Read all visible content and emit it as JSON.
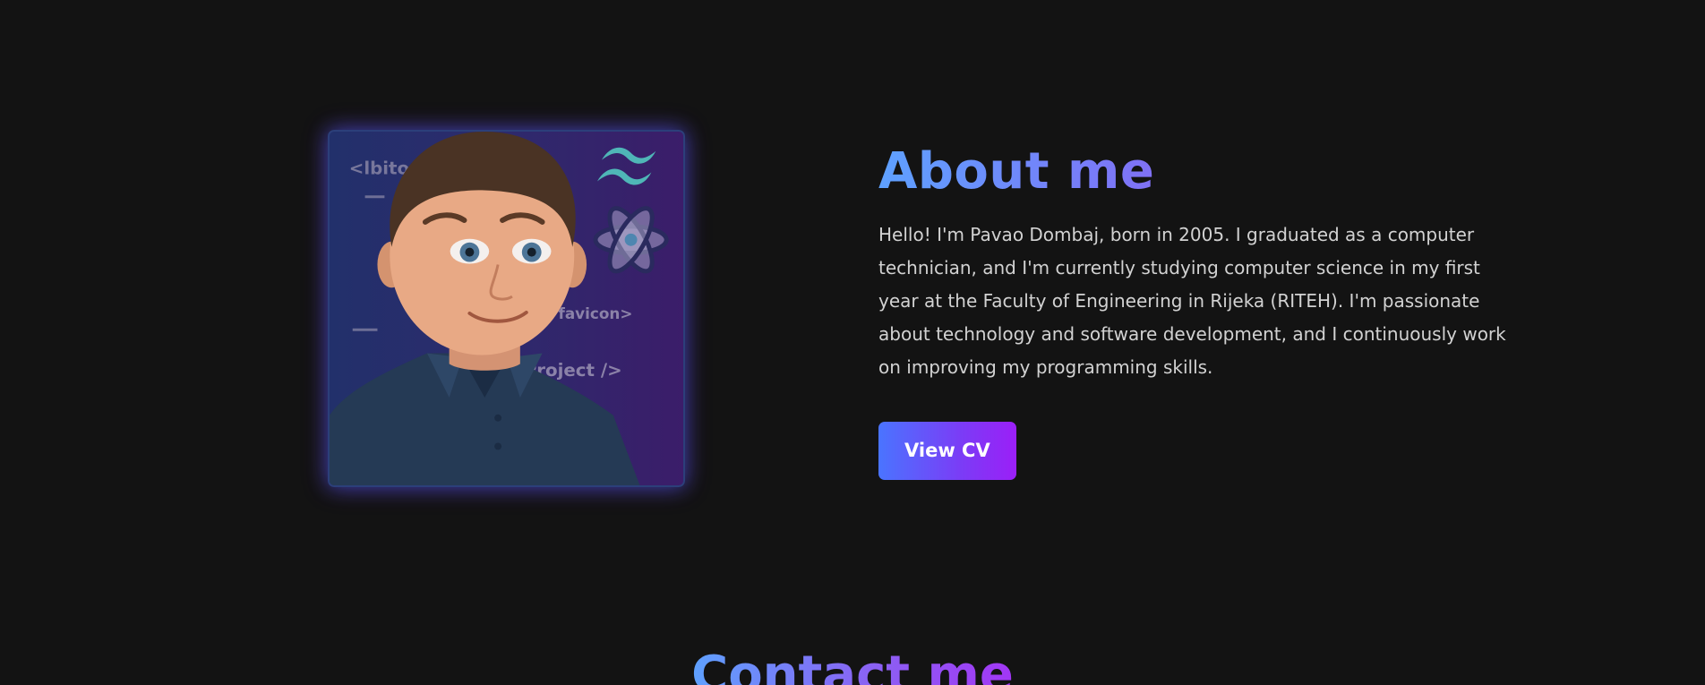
{
  "about": {
    "title": "About me",
    "paragraph": "Hello! I'm Pavao Dombaj, born in 2005. I graduated as a computer technician, and I'm currently studying computer science in my first year at the Faculty of Engineering in Rijeka (RITEH). I'm passionate about technology and software development, and I continuously work on improving my programming skills.",
    "cv_button_label": "View CV"
  },
  "portrait": {
    "code_tags": [
      "<lbitop",
      "favicon>",
      "Project />"
    ],
    "icons": [
      "tailwind-icon",
      "react-icon"
    ]
  },
  "contact": {
    "title": "Contact me"
  },
  "colors": {
    "background": "#131313",
    "gradient_start": "#5ea1ff",
    "gradient_end": "#a236f5",
    "text": "#d2d2d2"
  }
}
